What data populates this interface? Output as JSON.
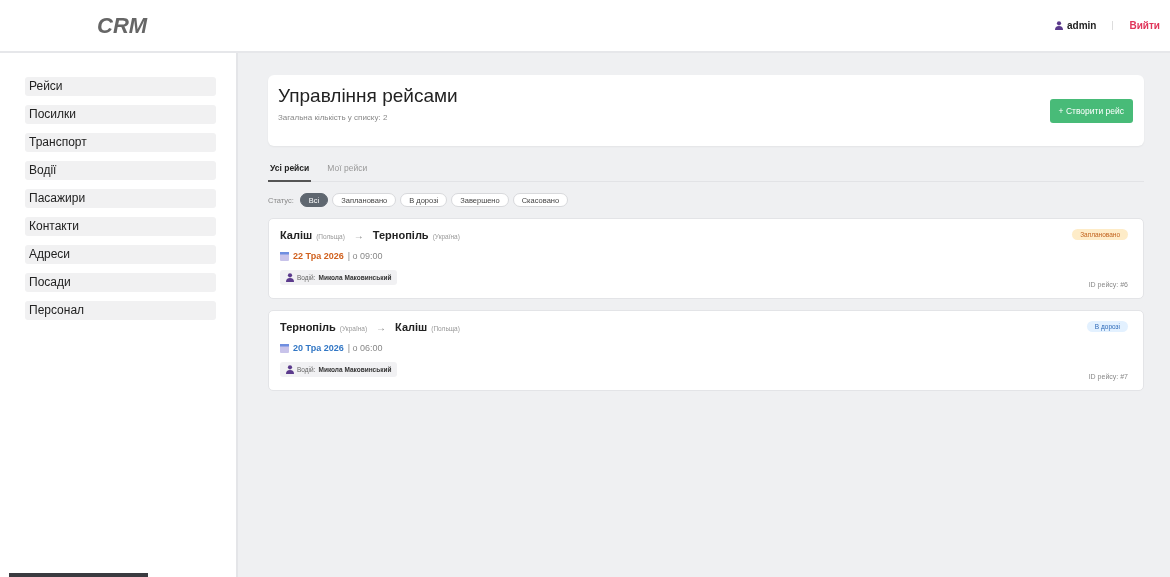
{
  "header": {
    "logo": "CRM",
    "user": "admin",
    "logout": "Вийти"
  },
  "sidebar": {
    "items": [
      {
        "label": "Рейси"
      },
      {
        "label": "Посилки"
      },
      {
        "label": "Транспорт"
      },
      {
        "label": "Водії"
      },
      {
        "label": "Пасажири"
      },
      {
        "label": "Контакти"
      },
      {
        "label": "Адреси"
      },
      {
        "label": "Посади"
      },
      {
        "label": "Персонал"
      }
    ]
  },
  "page": {
    "title": "Управління рейсами",
    "subtitle": "Загальна кількість у списку: 2",
    "create_button": "+ Створити рейс"
  },
  "tabs": [
    {
      "label": "Усі рейси",
      "selected": true
    },
    {
      "label": "Мої рейси",
      "selected": false
    }
  ],
  "filter": {
    "label": "Статус:",
    "options": [
      {
        "label": "Всі",
        "selected": true
      },
      {
        "label": "Заплановано",
        "selected": false
      },
      {
        "label": "В дорозі",
        "selected": false
      },
      {
        "label": "Завершено",
        "selected": false
      },
      {
        "label": "Скасовано",
        "selected": false
      }
    ]
  },
  "trips": [
    {
      "from": "Каліш",
      "from_country": "(Польща)",
      "arrow": "→",
      "to": "Тернопіль",
      "to_country": "(Україна)",
      "date": "22 Тра 2026",
      "time": "| о 09:00",
      "driver_label": "Водій:",
      "driver": "Микола Маковинський",
      "kind": "planned",
      "status_label": "Заплановано",
      "id": "ID рейсу: #6"
    },
    {
      "from": "Тернопіль",
      "from_country": "(Україна)",
      "arrow": "→",
      "to": "Каліш",
      "to_country": "(Польща)",
      "date": "20 Тра 2026",
      "time": "| о 06:00",
      "driver_label": "Водій:",
      "driver": "Микола Маковинський",
      "kind": "in_transit",
      "status_label": "В дорозі",
      "id": "ID рейсу: #7"
    }
  ]
}
